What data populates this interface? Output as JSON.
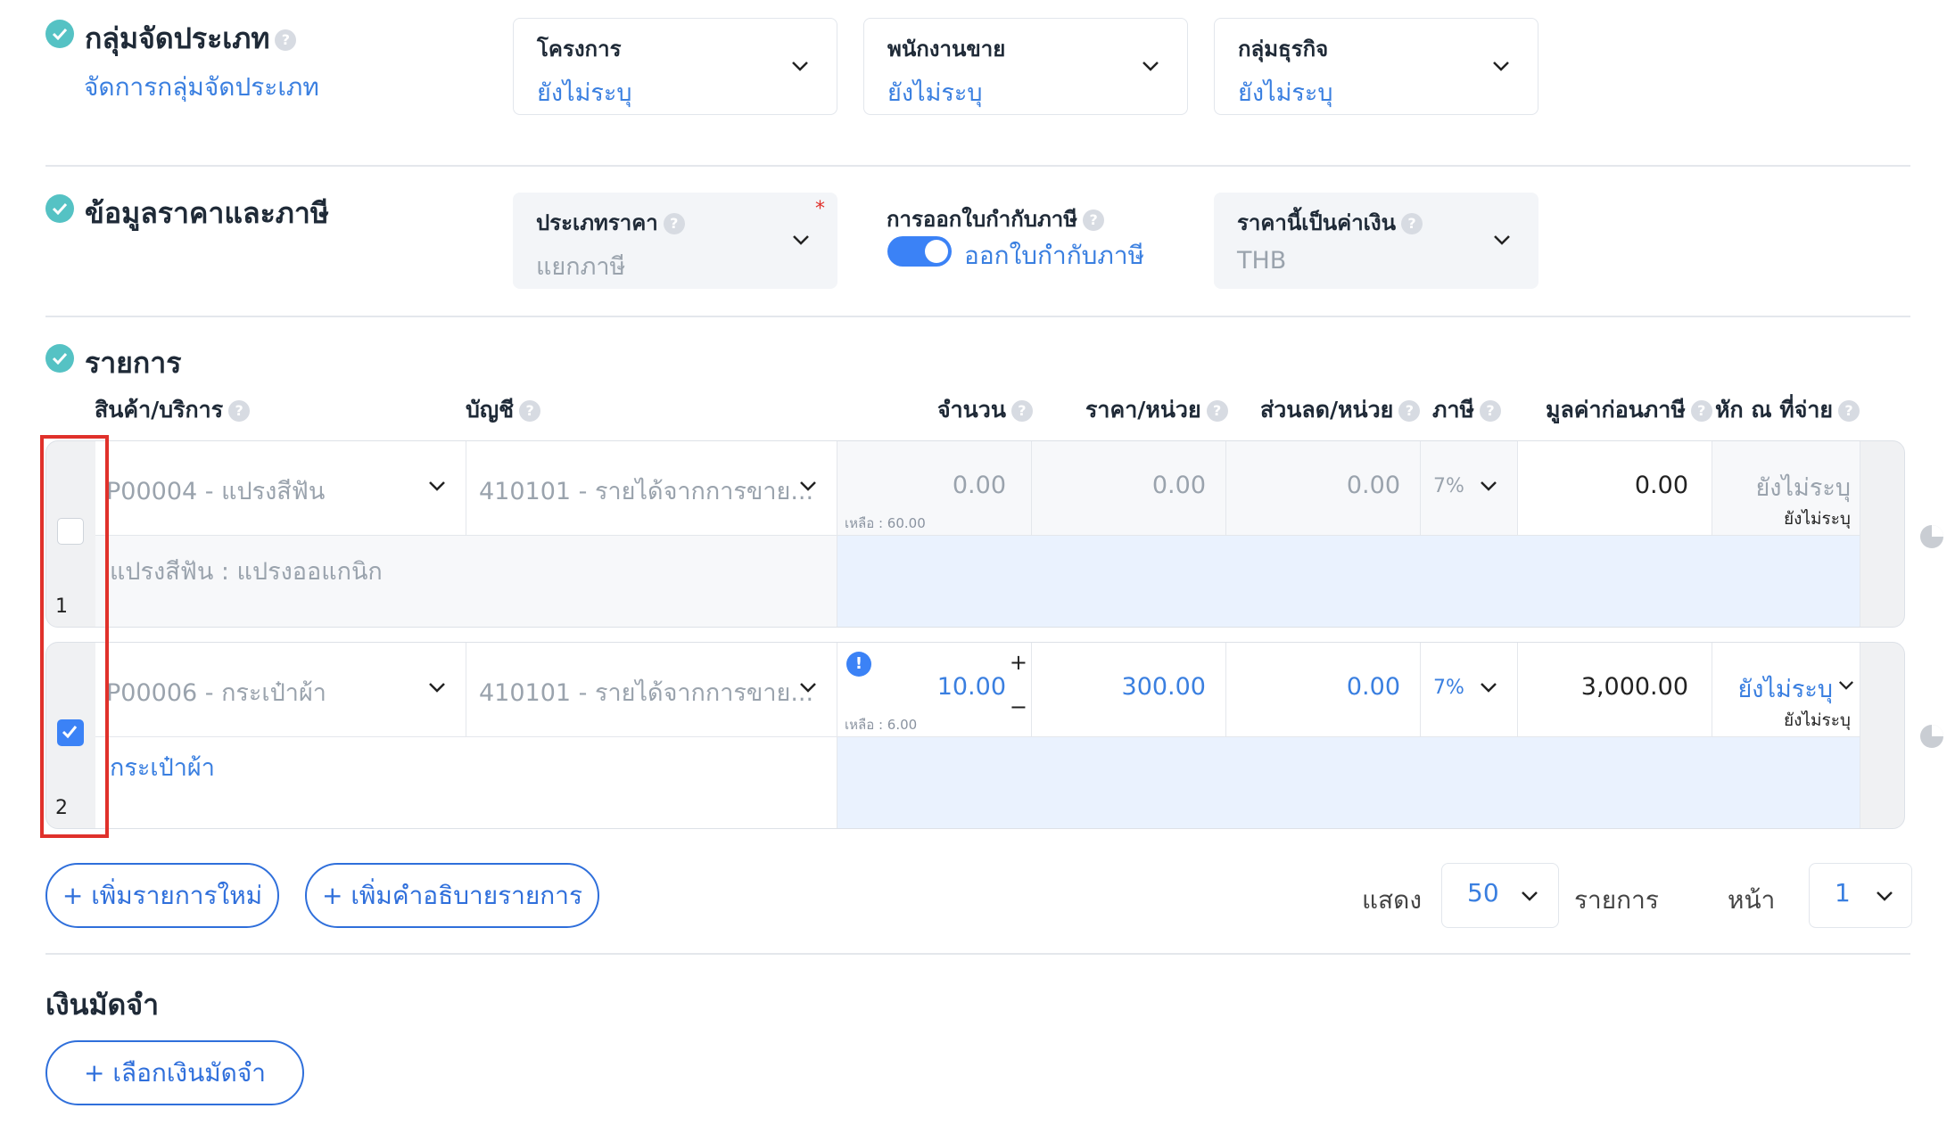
{
  "group_section": {
    "title": "กลุ่มจัดประเภท",
    "manage_link": "จัดการกลุ่มจัดประเภท",
    "fields": [
      {
        "label": "โครงการ",
        "value": "ยังไม่ระบุ"
      },
      {
        "label": "พนักงานขาย",
        "value": "ยังไม่ระบุ"
      },
      {
        "label": "กลุ่มธุรกิจ",
        "value": "ยังไม่ระบุ"
      }
    ]
  },
  "price_section": {
    "title": "ข้อมูลราคาและภาษี",
    "price_type": {
      "label": "ประเภทราคา",
      "value": "แยกภาษี",
      "required_mark": "*"
    },
    "tax_invoice": {
      "label": "การออกใบกำกับภาษี",
      "toggle_label": "ออกใบกำกับภาษี",
      "enabled": true
    },
    "currency": {
      "label": "ราคานี้เป็นค่าเงิน",
      "value": "THB"
    }
  },
  "items_section": {
    "title": "รายการ",
    "columns": [
      "สินค้า/บริการ",
      "บัญชี",
      "จำนวน",
      "ราคา/หน่วย",
      "ส่วนลด/หน่วย",
      "ภาษี",
      "มูลค่าก่อนภาษี",
      "หัก ณ ที่จ่าย"
    ],
    "rows": [
      {
        "index": "1",
        "checked": false,
        "product": "P00004 - แปรงสีฟัน",
        "account": "410101 - รายได้จากการขาย...",
        "quantity": "0.00",
        "remaining": "เหลือ : 60.00",
        "price": "0.00",
        "discount": "0.00",
        "tax": "7%",
        "pre_tax": "0.00",
        "wht": "ยังไม่ระบุ",
        "wht_sub": "ยังไม่ระบุ",
        "description": "แปรงสีฟัน : แปรงออแกนิก"
      },
      {
        "index": "2",
        "checked": true,
        "product": "P00006 - กระเป๋าผ้า",
        "account": "410101 - รายได้จากการขาย...",
        "quantity": "10.00",
        "remaining": "เหลือ : 6.00",
        "price": "300.00",
        "discount": "0.00",
        "tax": "7%",
        "pre_tax": "3,000.00",
        "wht": "ยังไม่ระบุ",
        "wht_sub": "ยังไม่ระบุ",
        "description": "กระเป๋าผ้า",
        "warning": "!",
        "plus": "+",
        "minus": "−"
      }
    ],
    "add_item_button": "+ เพิ่มรายการใหม่",
    "add_desc_button": "+ เพิ่มคำอธิบายรายการ",
    "show_label": "แสดง",
    "page_size": "50",
    "items_label": "รายการ",
    "page_label": "หน้า",
    "page": "1"
  },
  "deposit_section": {
    "title": "เงินมัดจำ",
    "select_button": "+ เลือกเงินมัดจำ"
  },
  "colors": {
    "accent": "#3a7fe0",
    "check": "#55c2c4",
    "highlight": "#e0312b"
  }
}
